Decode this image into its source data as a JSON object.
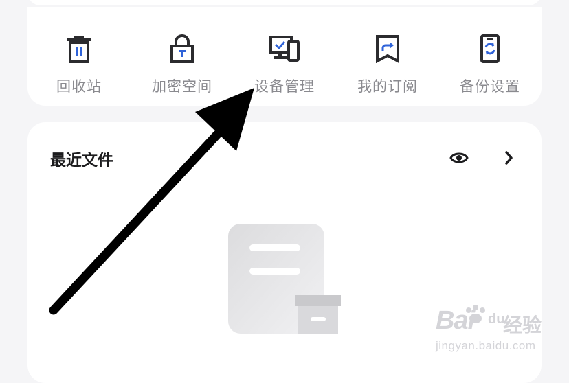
{
  "tools": [
    {
      "label": "回收站",
      "icon": "trash-icon"
    },
    {
      "label": "加密空间",
      "icon": "lock-icon"
    },
    {
      "label": "设备管理",
      "icon": "devices-icon"
    },
    {
      "label": "我的订阅",
      "icon": "bookmark-share-icon"
    },
    {
      "label": "备份设置",
      "icon": "phone-sync-icon"
    }
  ],
  "recent": {
    "title": "最近文件",
    "view_icon": "eye-icon",
    "more_icon": "chevron-right-icon",
    "empty_illustration": "empty-document-box-icon"
  },
  "overlay": {
    "arrow": "annotation-arrow",
    "watermark": {
      "brand": "Bai",
      "brand2": "du",
      "product": "经验",
      "url": "jingyan.baidu.com"
    }
  },
  "colors": {
    "accent": "#2f63d9",
    "icon": "#2b2b2e",
    "label": "#8a8a8f",
    "card": "#ffffff",
    "bg": "#f5f5f7"
  }
}
